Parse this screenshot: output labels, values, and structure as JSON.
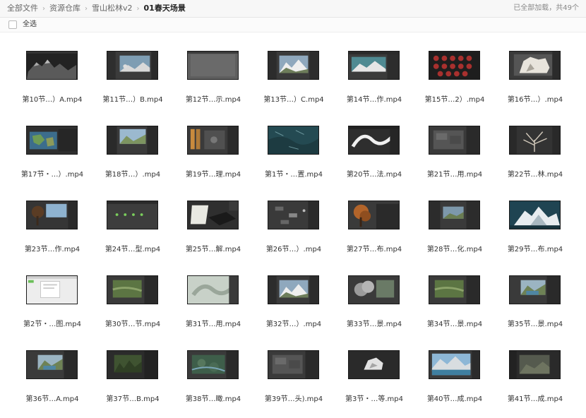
{
  "breadcrumb": {
    "items": [
      "全部文件",
      "资源仓库",
      "雪山松林v2",
      "01春天场景"
    ],
    "separator": "›"
  },
  "status": {
    "text": "已全部加载，共49个"
  },
  "toolbar": {
    "select_all_label": "全选"
  },
  "files": [
    {
      "name": "第10节…）A.mp4",
      "icon": "video-thumbnail",
      "style": "dark-mountain"
    },
    {
      "name": "第11节…）B.mp4",
      "icon": "video-thumbnail",
      "style": "editor-sky"
    },
    {
      "name": "第12节…示.mp4",
      "icon": "video-thumbnail",
      "style": "gray-flat"
    },
    {
      "name": "第13节…）C.mp4",
      "icon": "video-thumbnail",
      "style": "editor-mountain"
    },
    {
      "name": "第14节…作.mp4",
      "icon": "video-thumbnail",
      "style": "editor-teal"
    },
    {
      "name": "第15节…2）.mp4",
      "icon": "video-thumbnail",
      "style": "red-spheres"
    },
    {
      "name": "第16节…）.mp4",
      "icon": "video-thumbnail",
      "style": "white-rock"
    },
    {
      "name": "第17节・…）.mp4",
      "icon": "video-thumbnail",
      "style": "map-blue"
    },
    {
      "name": "第18节…）.mp4",
      "icon": "video-thumbnail",
      "style": "editor-green"
    },
    {
      "name": "第19节…理.mp4",
      "icon": "video-thumbnail",
      "style": "editor-orange"
    },
    {
      "name": "第1节・…置.mp4",
      "icon": "video-thumbnail",
      "style": "aerial-teal"
    },
    {
      "name": "第20节…法.mp4",
      "icon": "video-thumbnail",
      "style": "white-curve"
    },
    {
      "name": "第21节…用.mp4",
      "icon": "video-thumbnail",
      "style": "editor-gray"
    },
    {
      "name": "第22节…林.mp4",
      "icon": "video-thumbnail",
      "style": "branches"
    },
    {
      "name": "第23节…作.mp4",
      "icon": "video-thumbnail",
      "style": "tree-sky"
    },
    {
      "name": "第24节…型.mp4",
      "icon": "video-thumbnail",
      "style": "green-dots"
    },
    {
      "name": "第25节…解.mp4",
      "icon": "video-thumbnail",
      "style": "light-plane"
    },
    {
      "name": "第26节…）.mp4",
      "icon": "video-thumbnail",
      "style": "editor-nodes"
    },
    {
      "name": "第27节…布.mp4",
      "icon": "video-thumbnail",
      "style": "autumn-tree"
    },
    {
      "name": "第28节…化.mp4",
      "icon": "video-thumbnail",
      "style": "editor-landscape"
    },
    {
      "name": "第29节…布.mp4",
      "icon": "video-thumbnail",
      "style": "snow-peak"
    },
    {
      "name": "第2节・…图.mp4",
      "icon": "video-thumbnail",
      "style": "white-window"
    },
    {
      "name": "第30节…节.mp4",
      "icon": "video-thumbnail",
      "style": "editor-field"
    },
    {
      "name": "第31节…用.mp4",
      "icon": "video-thumbnail",
      "style": "pale-terrain"
    },
    {
      "name": "第32节…）.mp4",
      "icon": "video-thumbnail",
      "style": "editor-mountain"
    },
    {
      "name": "第33节…景.mp4",
      "icon": "video-thumbnail",
      "style": "gray-cloud"
    },
    {
      "name": "第34节…景.mp4",
      "icon": "video-thumbnail",
      "style": "editor-field"
    },
    {
      "name": "第35节…景.mp4",
      "icon": "video-thumbnail",
      "style": "editor-lake"
    },
    {
      "name": "第36节…A.mp4",
      "icon": "video-thumbnail",
      "style": "editor-lake"
    },
    {
      "name": "第37节…B.mp4",
      "icon": "video-thumbnail",
      "style": "editor-forest"
    },
    {
      "name": "第38节…瞰.mp4",
      "icon": "video-thumbnail",
      "style": "aerial-forest"
    },
    {
      "name": "第39节…头).mp4",
      "icon": "video-thumbnail",
      "style": "editor-gray"
    },
    {
      "name": "第3节・…等.mp4",
      "icon": "video-thumbnail",
      "style": "rock-dark"
    },
    {
      "name": "第40节…成.mp4",
      "icon": "video-thumbnail",
      "style": "lake-blue"
    },
    {
      "name": "第41节…成.mp4",
      "icon": "video-thumbnail",
      "style": "editor-dark-land"
    }
  ]
}
